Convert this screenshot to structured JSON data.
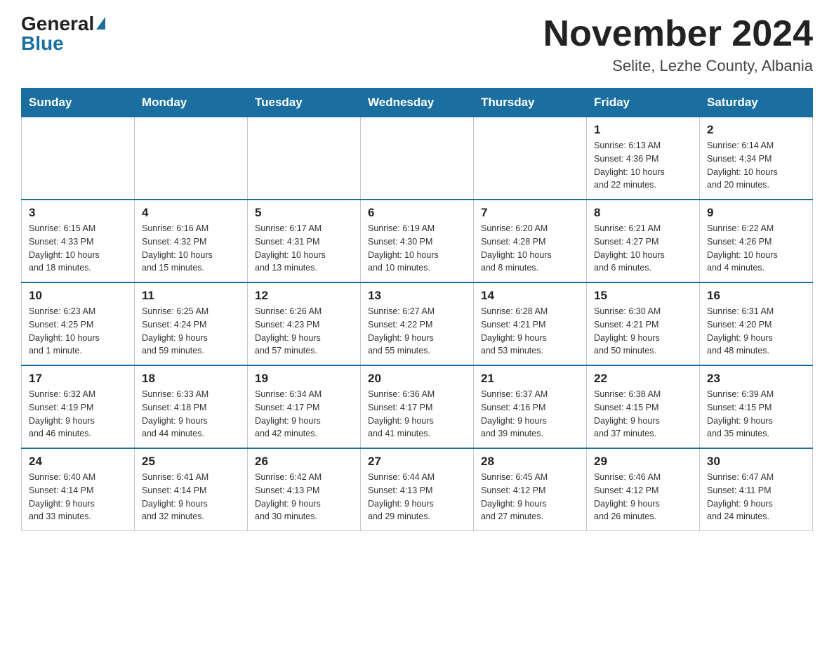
{
  "header": {
    "logo_general": "General",
    "logo_blue": "Blue",
    "month_title": "November 2024",
    "location": "Selite, Lezhe County, Albania"
  },
  "weekdays": [
    "Sunday",
    "Monday",
    "Tuesday",
    "Wednesday",
    "Thursday",
    "Friday",
    "Saturday"
  ],
  "weeks": [
    [
      {
        "day": "",
        "info": ""
      },
      {
        "day": "",
        "info": ""
      },
      {
        "day": "",
        "info": ""
      },
      {
        "day": "",
        "info": ""
      },
      {
        "day": "",
        "info": ""
      },
      {
        "day": "1",
        "info": "Sunrise: 6:13 AM\nSunset: 4:36 PM\nDaylight: 10 hours\nand 22 minutes."
      },
      {
        "day": "2",
        "info": "Sunrise: 6:14 AM\nSunset: 4:34 PM\nDaylight: 10 hours\nand 20 minutes."
      }
    ],
    [
      {
        "day": "3",
        "info": "Sunrise: 6:15 AM\nSunset: 4:33 PM\nDaylight: 10 hours\nand 18 minutes."
      },
      {
        "day": "4",
        "info": "Sunrise: 6:16 AM\nSunset: 4:32 PM\nDaylight: 10 hours\nand 15 minutes."
      },
      {
        "day": "5",
        "info": "Sunrise: 6:17 AM\nSunset: 4:31 PM\nDaylight: 10 hours\nand 13 minutes."
      },
      {
        "day": "6",
        "info": "Sunrise: 6:19 AM\nSunset: 4:30 PM\nDaylight: 10 hours\nand 10 minutes."
      },
      {
        "day": "7",
        "info": "Sunrise: 6:20 AM\nSunset: 4:28 PM\nDaylight: 10 hours\nand 8 minutes."
      },
      {
        "day": "8",
        "info": "Sunrise: 6:21 AM\nSunset: 4:27 PM\nDaylight: 10 hours\nand 6 minutes."
      },
      {
        "day": "9",
        "info": "Sunrise: 6:22 AM\nSunset: 4:26 PM\nDaylight: 10 hours\nand 4 minutes."
      }
    ],
    [
      {
        "day": "10",
        "info": "Sunrise: 6:23 AM\nSunset: 4:25 PM\nDaylight: 10 hours\nand 1 minute."
      },
      {
        "day": "11",
        "info": "Sunrise: 6:25 AM\nSunset: 4:24 PM\nDaylight: 9 hours\nand 59 minutes."
      },
      {
        "day": "12",
        "info": "Sunrise: 6:26 AM\nSunset: 4:23 PM\nDaylight: 9 hours\nand 57 minutes."
      },
      {
        "day": "13",
        "info": "Sunrise: 6:27 AM\nSunset: 4:22 PM\nDaylight: 9 hours\nand 55 minutes."
      },
      {
        "day": "14",
        "info": "Sunrise: 6:28 AM\nSunset: 4:21 PM\nDaylight: 9 hours\nand 53 minutes."
      },
      {
        "day": "15",
        "info": "Sunrise: 6:30 AM\nSunset: 4:21 PM\nDaylight: 9 hours\nand 50 minutes."
      },
      {
        "day": "16",
        "info": "Sunrise: 6:31 AM\nSunset: 4:20 PM\nDaylight: 9 hours\nand 48 minutes."
      }
    ],
    [
      {
        "day": "17",
        "info": "Sunrise: 6:32 AM\nSunset: 4:19 PM\nDaylight: 9 hours\nand 46 minutes."
      },
      {
        "day": "18",
        "info": "Sunrise: 6:33 AM\nSunset: 4:18 PM\nDaylight: 9 hours\nand 44 minutes."
      },
      {
        "day": "19",
        "info": "Sunrise: 6:34 AM\nSunset: 4:17 PM\nDaylight: 9 hours\nand 42 minutes."
      },
      {
        "day": "20",
        "info": "Sunrise: 6:36 AM\nSunset: 4:17 PM\nDaylight: 9 hours\nand 41 minutes."
      },
      {
        "day": "21",
        "info": "Sunrise: 6:37 AM\nSunset: 4:16 PM\nDaylight: 9 hours\nand 39 minutes."
      },
      {
        "day": "22",
        "info": "Sunrise: 6:38 AM\nSunset: 4:15 PM\nDaylight: 9 hours\nand 37 minutes."
      },
      {
        "day": "23",
        "info": "Sunrise: 6:39 AM\nSunset: 4:15 PM\nDaylight: 9 hours\nand 35 minutes."
      }
    ],
    [
      {
        "day": "24",
        "info": "Sunrise: 6:40 AM\nSunset: 4:14 PM\nDaylight: 9 hours\nand 33 minutes."
      },
      {
        "day": "25",
        "info": "Sunrise: 6:41 AM\nSunset: 4:14 PM\nDaylight: 9 hours\nand 32 minutes."
      },
      {
        "day": "26",
        "info": "Sunrise: 6:42 AM\nSunset: 4:13 PM\nDaylight: 9 hours\nand 30 minutes."
      },
      {
        "day": "27",
        "info": "Sunrise: 6:44 AM\nSunset: 4:13 PM\nDaylight: 9 hours\nand 29 minutes."
      },
      {
        "day": "28",
        "info": "Sunrise: 6:45 AM\nSunset: 4:12 PM\nDaylight: 9 hours\nand 27 minutes."
      },
      {
        "day": "29",
        "info": "Sunrise: 6:46 AM\nSunset: 4:12 PM\nDaylight: 9 hours\nand 26 minutes."
      },
      {
        "day": "30",
        "info": "Sunrise: 6:47 AM\nSunset: 4:11 PM\nDaylight: 9 hours\nand 24 minutes."
      }
    ]
  ]
}
